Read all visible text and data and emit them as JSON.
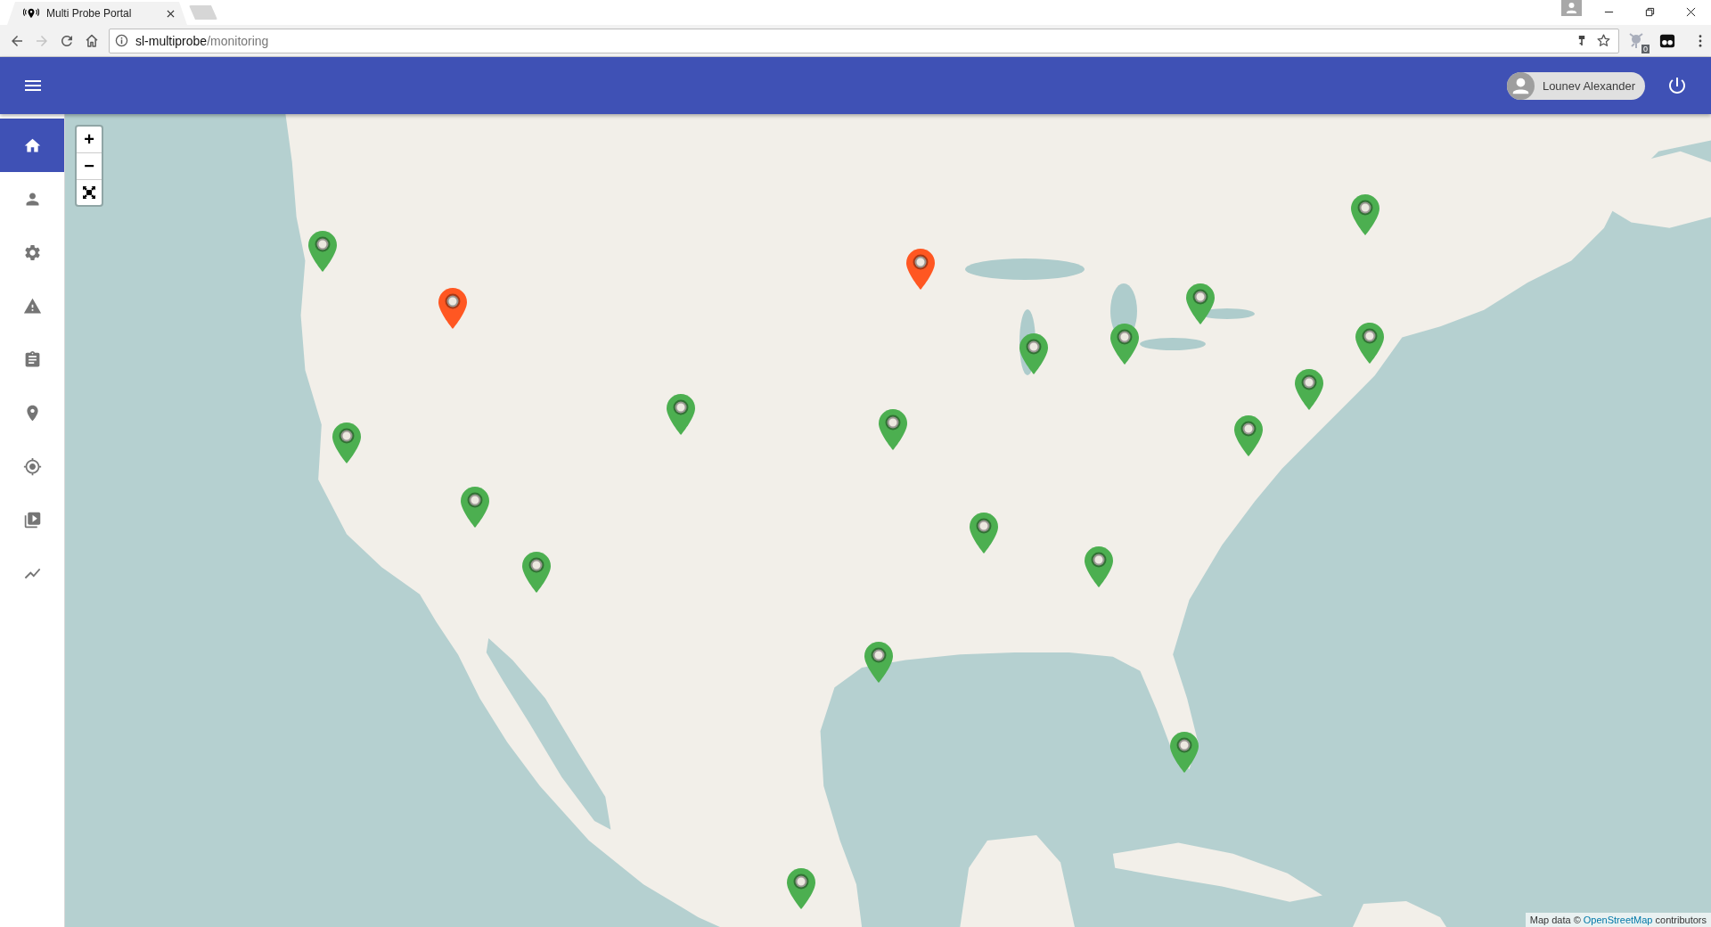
{
  "browser": {
    "tabs": [
      {
        "title": "Multi Probe Portal",
        "selected": true
      }
    ],
    "back": {
      "disabled": false
    },
    "forward": {
      "disabled": true
    },
    "address": {
      "host": "sl-multiprobe",
      "path": "/monitoring"
    },
    "extension_badge": "0"
  },
  "header": {
    "user_name": "Lounev Alexander"
  },
  "sidebar": {
    "items": [
      {
        "selected": true
      },
      {
        "selected": false
      },
      {
        "selected": false
      },
      {
        "selected": false
      },
      {
        "selected": false
      },
      {
        "selected": false
      },
      {
        "selected": false
      },
      {
        "selected": false
      },
      {
        "selected": false
      }
    ]
  },
  "map": {
    "zoom_in": "+",
    "zoom_out": "−",
    "markers": [
      {
        "color": "#4caf50"
      },
      {
        "color": "#4caf50"
      },
      {
        "color": "#ff5722"
      },
      {
        "color": "#ff5722"
      },
      {
        "color": "#4caf50"
      },
      {
        "color": "#4caf50"
      },
      {
        "color": "#4caf50"
      },
      {
        "color": "#4caf50"
      },
      {
        "color": "#4caf50"
      },
      {
        "color": "#4caf50"
      },
      {
        "color": "#4caf50"
      },
      {
        "color": "#4caf50"
      },
      {
        "color": "#4caf50"
      },
      {
        "color": "#4caf50"
      },
      {
        "color": "#4caf50"
      },
      {
        "color": "#4caf50"
      },
      {
        "color": "#4caf50"
      },
      {
        "color": "#4caf50"
      },
      {
        "color": "#4caf50"
      },
      {
        "color": "#4caf50"
      }
    ],
    "attribution": {
      "prefix": "Map data ©",
      "link": "OpenStreetMap",
      "suffix": "contributors"
    }
  }
}
